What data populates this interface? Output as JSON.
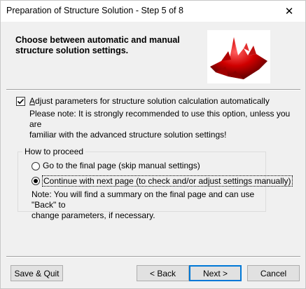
{
  "window": {
    "title": "Preparation of Structure Solution - Step 5 of 8",
    "close_glyph": "✕"
  },
  "header": {
    "line1": "Choose between automatic and manual",
    "line2": "structure solution settings."
  },
  "auto_option": {
    "checked": true,
    "label_first": "A",
    "label_rest": "djust parameters for structure solution calculation automatically",
    "note_line1": "Please note: It is strongly recommended to use this option, unless you are",
    "note_line2": "familiar with the advanced structure solution settings!"
  },
  "proceed": {
    "legend": "How to proceed",
    "options": [
      {
        "label": "Go to the final page (skip manual settings)",
        "selected": false
      },
      {
        "label": "Continue with next page (to check and/or adjust settings manually)",
        "selected": true
      }
    ],
    "note_line1": "Note: You will find a summary on the final page and can use \"Back\" to",
    "note_line2": "change parameters, if necessary."
  },
  "buttons": {
    "save_quit": "Save & Quit",
    "back": "< Back",
    "next": "Next >",
    "cancel": "Cancel"
  },
  "logo_icon": "red-3d-surface-plot-icon"
}
